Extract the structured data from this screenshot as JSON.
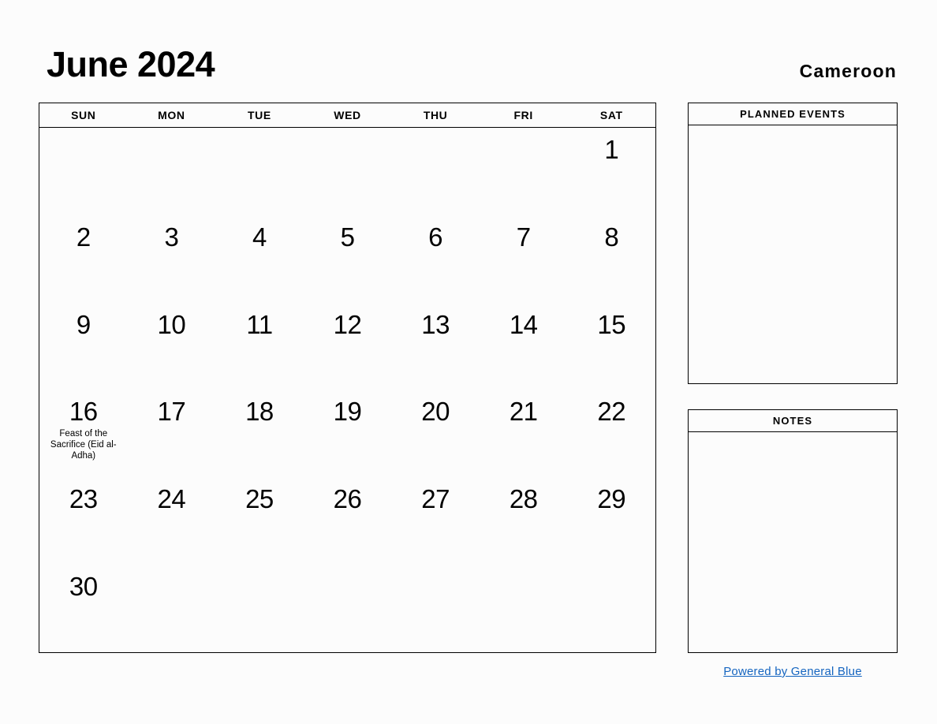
{
  "header": {
    "month_title": "June 2024",
    "country": "Cameroon"
  },
  "calendar": {
    "weekdays": [
      "SUN",
      "MON",
      "TUE",
      "WED",
      "THU",
      "FRI",
      "SAT"
    ],
    "weeks": [
      [
        {
          "day": ""
        },
        {
          "day": ""
        },
        {
          "day": ""
        },
        {
          "day": ""
        },
        {
          "day": ""
        },
        {
          "day": ""
        },
        {
          "day": "1"
        }
      ],
      [
        {
          "day": "2"
        },
        {
          "day": "3"
        },
        {
          "day": "4"
        },
        {
          "day": "5"
        },
        {
          "day": "6"
        },
        {
          "day": "7"
        },
        {
          "day": "8"
        }
      ],
      [
        {
          "day": "9"
        },
        {
          "day": "10"
        },
        {
          "day": "11"
        },
        {
          "day": "12"
        },
        {
          "day": "13"
        },
        {
          "day": "14"
        },
        {
          "day": "15"
        }
      ],
      [
        {
          "day": "16",
          "event": "Feast of the Sacrifice (Eid al-Adha)"
        },
        {
          "day": "17"
        },
        {
          "day": "18"
        },
        {
          "day": "19"
        },
        {
          "day": "20"
        },
        {
          "day": "21"
        },
        {
          "day": "22"
        }
      ],
      [
        {
          "day": "23"
        },
        {
          "day": "24"
        },
        {
          "day": "25"
        },
        {
          "day": "26"
        },
        {
          "day": "27"
        },
        {
          "day": "28"
        },
        {
          "day": "29"
        }
      ],
      [
        {
          "day": "30"
        },
        {
          "day": ""
        },
        {
          "day": ""
        },
        {
          "day": ""
        },
        {
          "day": ""
        },
        {
          "day": ""
        },
        {
          "day": ""
        }
      ]
    ]
  },
  "panels": {
    "planned_events_title": "PLANNED EVENTS",
    "notes_title": "NOTES"
  },
  "footer": {
    "link_text": "Powered by General Blue",
    "link_color": "#1565c0"
  }
}
